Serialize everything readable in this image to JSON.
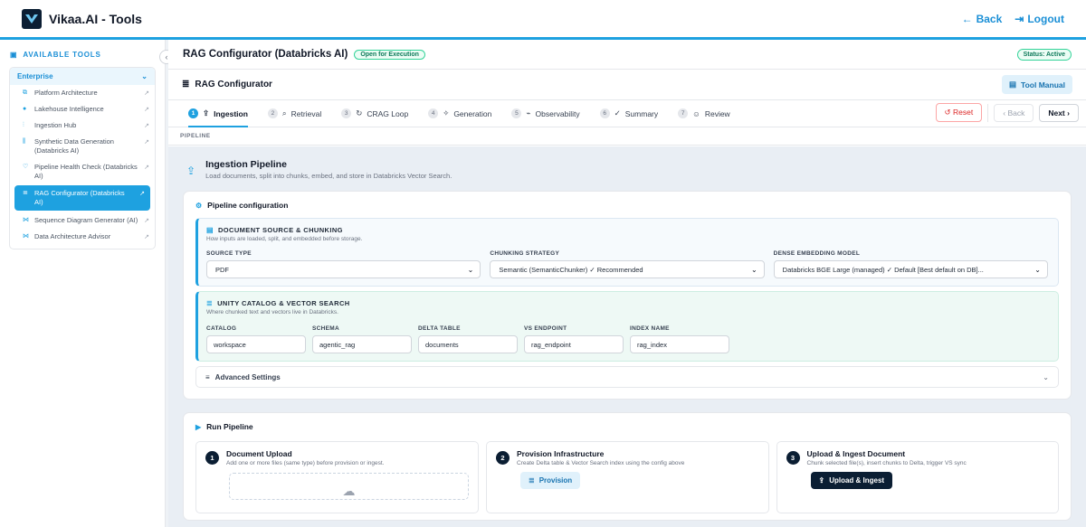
{
  "app": {
    "title": "Vikaa.AI - Tools",
    "back_label": "Back",
    "logout_label": "Logout"
  },
  "sidebar": {
    "title": "AVAILABLE TOOLS",
    "group_label": "Enterprise",
    "items": [
      {
        "label": "Platform Architecture",
        "icon": "sitemap-icon"
      },
      {
        "label": "Lakehouse Intelligence",
        "icon": "info-icon"
      },
      {
        "label": "Ingestion Hub",
        "icon": "pipeline-icon"
      },
      {
        "label": "Synthetic Data Generation (Databricks AI)",
        "icon": "columns-icon"
      },
      {
        "label": "Pipeline Health Check (Databricks AI)",
        "icon": "heart-icon"
      },
      {
        "label": "RAG Configurator (Databricks AI)",
        "icon": "database-icon"
      },
      {
        "label": "Sequence Diagram Generator (AI)",
        "icon": "diagram-icon"
      },
      {
        "label": "Data Architecture Advisor",
        "icon": "diagram-icon"
      }
    ]
  },
  "header": {
    "page_title": "RAG Configurator (Databricks AI)",
    "open_badge": "Open for Execution",
    "status_badge": "Status: Active",
    "tool_title": "RAG Configurator",
    "manual_label": "Tool Manual"
  },
  "steps": [
    {
      "num": "1",
      "label": "Ingestion",
      "icon": "upload-icon"
    },
    {
      "num": "2",
      "label": "Retrieval",
      "icon": "search-icon"
    },
    {
      "num": "3",
      "label": "CRAG Loop",
      "icon": "refresh-icon"
    },
    {
      "num": "4",
      "label": "Generation",
      "icon": "wand-icon"
    },
    {
      "num": "5",
      "label": "Observability",
      "icon": "chart-icon"
    },
    {
      "num": "6",
      "label": "Summary",
      "icon": "checklist-icon"
    },
    {
      "num": "7",
      "label": "Review",
      "icon": "user-check-icon"
    }
  ],
  "nav": {
    "reset": "Reset",
    "back": "Back",
    "next": "Next"
  },
  "pipeline_label": "PIPELINE",
  "ingestion": {
    "title": "Ingestion Pipeline",
    "subtitle": "Load documents, split into chunks, embed, and store in Databricks Vector Search."
  },
  "config": {
    "title": "Pipeline configuration",
    "doc_section": {
      "title": "DOCUMENT SOURCE & CHUNKING",
      "subtitle": "How inputs are loaded, split, and embedded before storage.",
      "source_label": "SOURCE TYPE",
      "source_value": "PDF",
      "chunking_label": "CHUNKING STRATEGY",
      "chunking_value": "Semantic (SemanticChunker) ✓ Recommended",
      "embedding_label": "DENSE EMBEDDING MODEL",
      "embedding_value": "Databricks BGE Large (managed) ✓ Default [Best default on DB]..."
    },
    "uc_section": {
      "title": "UNITY CATALOG & VECTOR SEARCH",
      "subtitle": "Where chunked text and vectors live in Databricks.",
      "catalog_label": "CATALOG",
      "catalog_value": "workspace",
      "schema_label": "SCHEMA",
      "schema_value": "agentic_rag",
      "table_label": "DELTA TABLE",
      "table_value": "documents",
      "endpoint_label": "VS ENDPOINT",
      "endpoint_value": "rag_endpoint",
      "index_label": "INDEX NAME",
      "index_value": "rag_index"
    },
    "advanced_label": "Advanced Settings"
  },
  "run": {
    "title": "Run Pipeline",
    "upload": {
      "num": "1",
      "title": "Document Upload",
      "subtitle": "Add one or more files (same type) before provision or ingest."
    },
    "provision": {
      "num": "2",
      "title": "Provision Infrastructure",
      "subtitle": "Create Delta table & Vector Search index using the config above",
      "button": "Provision"
    },
    "ingest": {
      "num": "3",
      "title": "Upload & Ingest Document",
      "subtitle": "Chunk selected file(s), insert chunks to Delta, trigger VS sync",
      "button": "Upload & Ingest"
    }
  },
  "colors": {
    "accent": "#1ea1e0",
    "navy": "#0b1e33",
    "success": "#0e7a5a",
    "danger": "#dc2626"
  }
}
